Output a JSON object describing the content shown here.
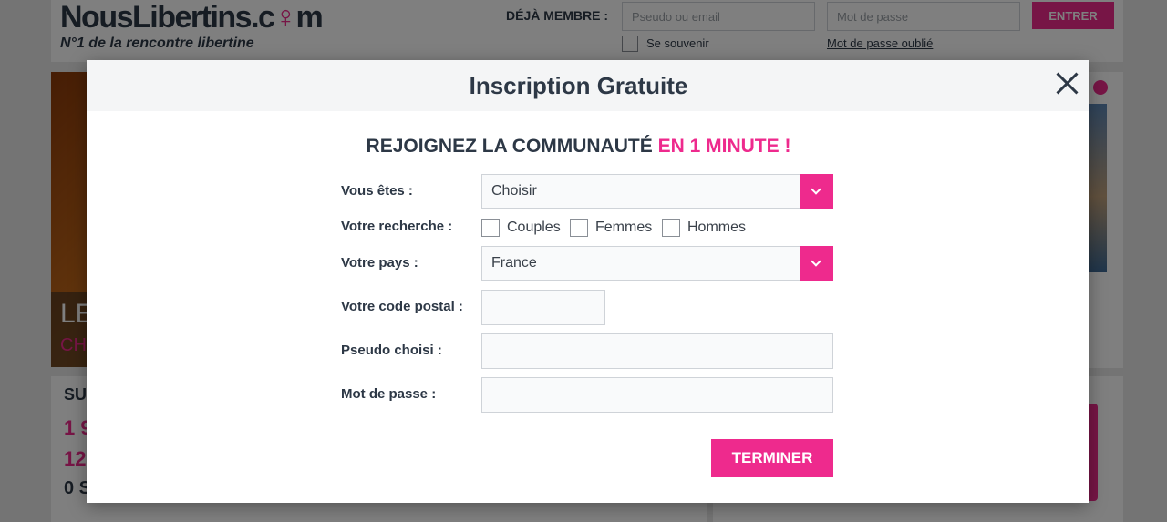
{
  "header": {
    "logo_prefix": "NousLibertins.c",
    "logo_suffix": "m",
    "tagline": "N°1 de la rencontre libertine",
    "member_label": "DÉJÀ MEMBRE :",
    "username_placeholder": "Pseudo ou email",
    "password_placeholder": "Mot de passe",
    "enter_label": "ENTRER",
    "remember_label": "Se souvenir",
    "forgot_label": "Mot de passe oublié"
  },
  "background": {
    "hero_title": "LE",
    "hero_sub": "CH",
    "stat_1": "SU",
    "stat_2": "1 9",
    "stat_3": "12",
    "stat_4": "0 S"
  },
  "modal": {
    "title": "Inscription Gratuite",
    "heading_main": "REJOIGNEZ LA COMMUNAUTÉ ",
    "heading_accent": "EN 1 MINUTE !",
    "gender_label": "Vous êtes :",
    "gender_value": "Choisir",
    "search_label": "Votre recherche :",
    "search_options": [
      "Couples",
      "Femmes",
      "Hommes"
    ],
    "country_label": "Votre pays :",
    "country_value": "France",
    "postal_label": "Votre code postal :",
    "pseudo_label": "Pseudo choisi :",
    "password_label": "Mot de passe :",
    "submit_label": "TERMINER"
  },
  "colors": {
    "accent": "#ee2a8d",
    "text": "#2d3846"
  }
}
